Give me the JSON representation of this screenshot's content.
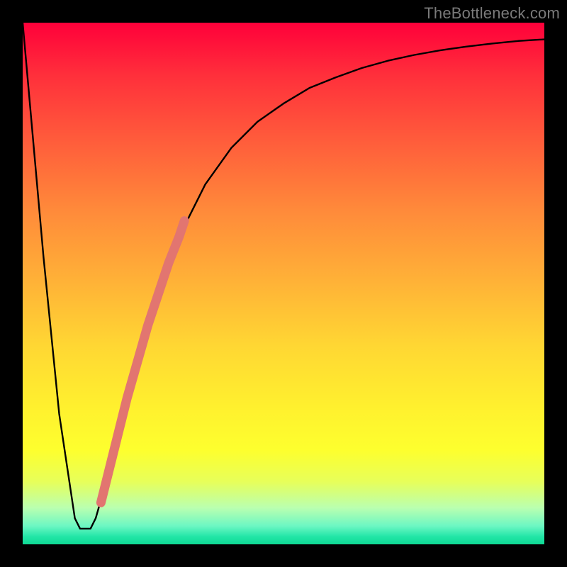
{
  "watermark": "TheBottleneck.com",
  "colors": {
    "curve": "#000000",
    "dots": "#e27570",
    "dots_stroke": "#a54d49"
  },
  "chart_data": {
    "type": "line",
    "title": "",
    "xlabel": "",
    "ylabel": "",
    "xlim": [
      0,
      100
    ],
    "ylim": [
      0,
      100
    ],
    "grid": false,
    "series": [
      {
        "name": "bottleneck-curve",
        "x": [
          0,
          4,
          7,
          10,
          11,
          12,
          13,
          14,
          16,
          18,
          20,
          22,
          24,
          26,
          28,
          30,
          32,
          35,
          40,
          45,
          50,
          55,
          60,
          65,
          70,
          75,
          80,
          85,
          90,
          95,
          100
        ],
        "values": [
          100,
          55,
          25,
          5,
          3,
          3,
          3,
          5,
          12,
          20,
          28,
          35,
          42,
          48,
          54,
          59,
          63,
          69,
          76,
          81,
          84.5,
          87.5,
          89.5,
          91.3,
          92.7,
          93.8,
          94.7,
          95.4,
          96,
          96.5,
          96.8
        ]
      }
    ],
    "highlight_segment": {
      "name": "thick-dotted-region",
      "x": [
        15,
        16,
        17,
        18,
        20,
        22,
        24,
        26,
        28,
        30,
        31
      ],
      "values": [
        8,
        12,
        16,
        20,
        28,
        35,
        42,
        48,
        54,
        59,
        62
      ]
    },
    "highlight_dots": {
      "name": "dot-markers",
      "x": [
        15.2,
        16.5,
        18.0,
        19.3
      ],
      "values": [
        9,
        14,
        20,
        25
      ],
      "radius": [
        5,
        5,
        5,
        5
      ]
    }
  }
}
